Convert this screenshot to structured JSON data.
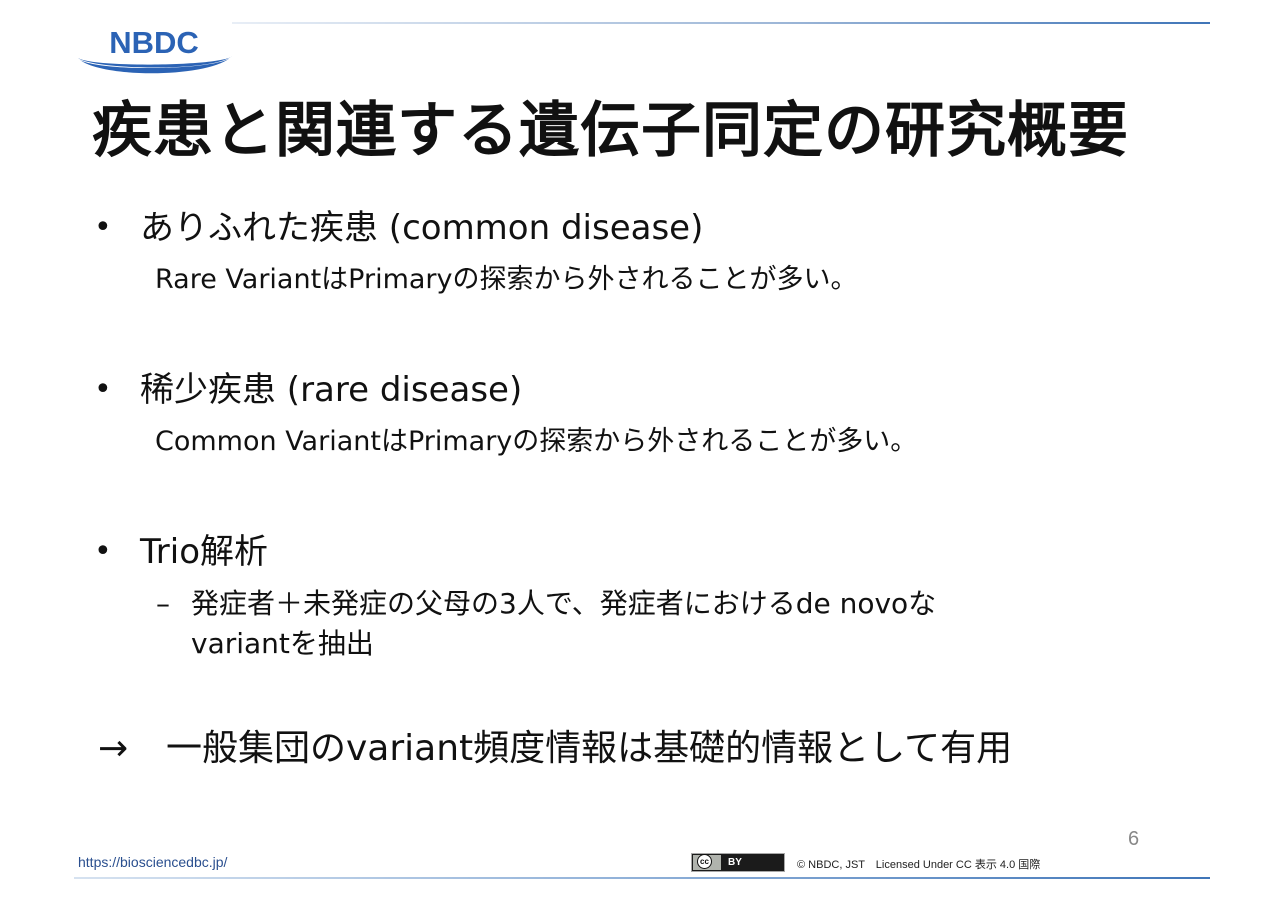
{
  "header": {
    "logo_text": "NBDC",
    "title": "疾患と関連する遺伝子同定の研究概要"
  },
  "colors": {
    "logo_blue": "#2b63b5",
    "rule_blue": "#3f75b8",
    "url_blue": "#2a4f8f",
    "page_number_gray": "#888888"
  },
  "bullets": [
    {
      "marker": "•",
      "text": "ありふれた疾患 (common disease)",
      "sub": "Rare VariantはPrimaryの探索から外されることが多い。"
    },
    {
      "marker": "•",
      "text": "稀少疾患 (rare disease)",
      "sub": "Common VariantはPrimaryの探索から外されることが多い。"
    },
    {
      "marker": "•",
      "text": "Trio解析",
      "dash_marker": "–",
      "dash_line1": "発症者＋未発症の父母の3人で、発症者におけるde novoな",
      "dash_line2": "variantを抽出"
    }
  ],
  "conclusion": {
    "arrow": "→",
    "text": "一般集団のvariant頻度情報は基礎的情報として有用"
  },
  "footer": {
    "page_number": "6",
    "url": "https://biosciencedbc.jp/",
    "cc_symbol": "cc",
    "cc_label": "BY",
    "license_text": "© NBDC, JST　Licensed Under CC 表示 4.0 国際"
  }
}
